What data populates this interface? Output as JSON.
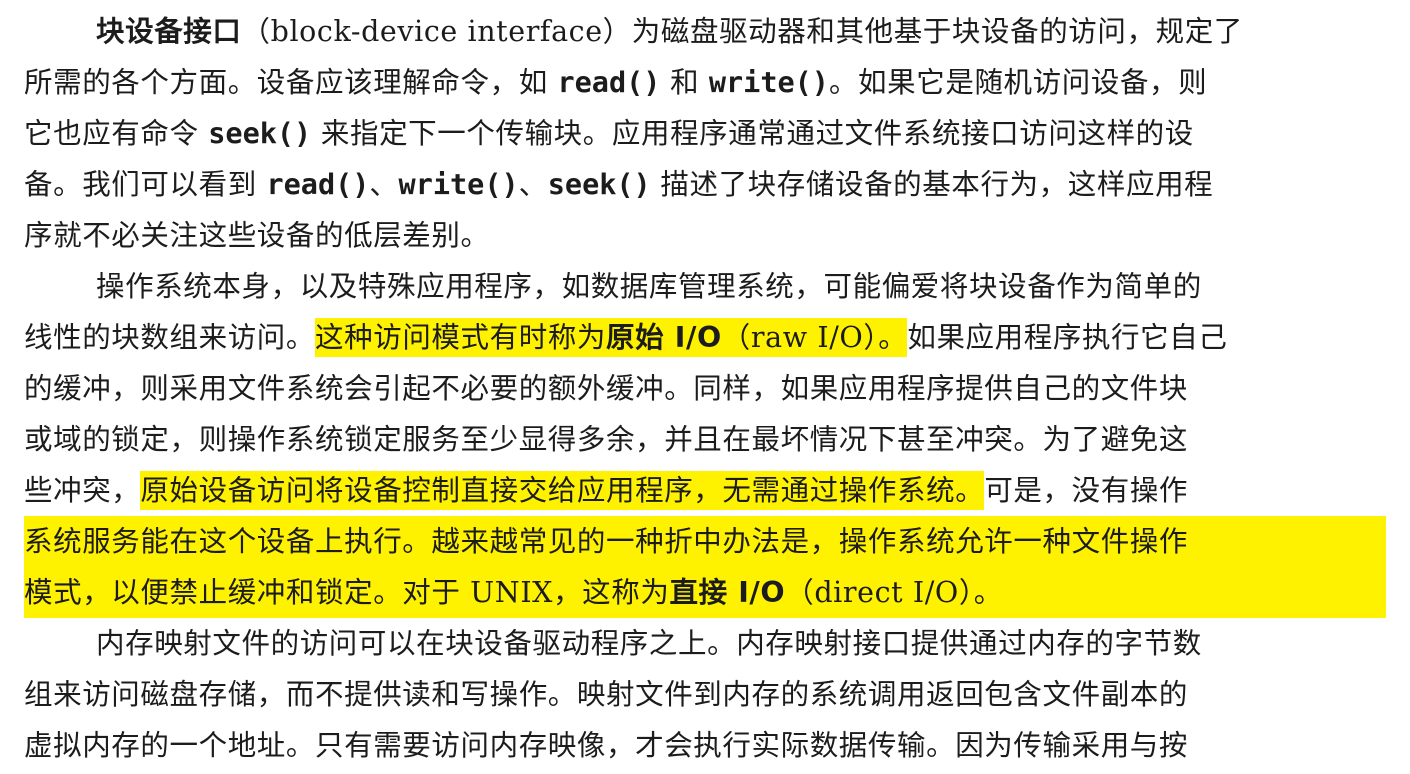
{
  "paragraphs": [
    {
      "lines": [
        [
          {
            "t": "块设备接口",
            "b": true
          },
          {
            "t": "（block-device interface）为磁盘驱动器和其他基于块设备的访问，规定了"
          }
        ],
        [
          {
            "t": "所需的各个方面。设备应该理解命令，如 "
          },
          {
            "t": "read()",
            "m": true
          },
          {
            "t": " 和 "
          },
          {
            "t": "write()",
            "m": true
          },
          {
            "t": "。如果它是随机访问设备，则"
          }
        ],
        [
          {
            "t": "它也应有命令 "
          },
          {
            "t": "seek()",
            "m": true
          },
          {
            "t": " 来指定下一个传输块。应用程序通常通过文件系统接口访问这样的设"
          }
        ],
        [
          {
            "t": "备。我们可以看到 "
          },
          {
            "t": "read()",
            "m": true
          },
          {
            "t": "、"
          },
          {
            "t": "write()",
            "m": true
          },
          {
            "t": "、"
          },
          {
            "t": "seek()",
            "m": true
          },
          {
            "t": " 描述了块存储设备的基本行为，这样应用程"
          }
        ],
        [
          {
            "t": "序就不必关注这些设备的低层差别。"
          }
        ]
      ]
    },
    {
      "lines": [
        [
          {
            "t": "操作系统本身，以及特殊应用程序，如数据库管理系统，可能偏爱将块设备作为简单的"
          }
        ],
        [
          {
            "t": "线性的块数组来访问。"
          },
          {
            "t": "这种访问模式有时称为",
            "h": true
          },
          {
            "t": "原始 I/O",
            "h": true,
            "b": true
          },
          {
            "t": "（raw I/O）。",
            "h": true
          },
          {
            "t": "如果应用程序执行它自己"
          }
        ],
        [
          {
            "t": "的缓冲，则采用文件系统会引起不必要的额外缓冲。同样，如果应用程序提供自己的文件块"
          }
        ],
        [
          {
            "t": "或域的锁定，则操作系统锁定服务至少显得多余，并且在最坏情况下甚至冲突。为了避免这"
          }
        ],
        [
          {
            "t": "些冲突，"
          },
          {
            "t": "原始设备访问将设备控制直接交给应用程序，无需通过操作系统。",
            "h": true
          },
          {
            "t": "可是，没有操作"
          }
        ],
        [
          {
            "t": "系统服务能在这个设备上执行。越来越常见的一种折中办法是，操作系统允许一种文件操作",
            "hb": true
          }
        ],
        [
          {
            "t": "模式，以便禁止缓冲和锁定。对于 UNIX，这称为",
            "hb": true
          },
          {
            "t": "直接 I/O",
            "hb": true,
            "b": true
          },
          {
            "t": "（direct I/O）。",
            "hb": true
          }
        ]
      ]
    },
    {
      "lines": [
        [
          {
            "t": "内存映射文件的访问可以在块设备驱动程序之上。内存映射接口提供通过内存的字节数"
          }
        ],
        [
          {
            "t": "组来访问磁盘存储，而不提供读和写操作。映射文件到内存的系统调用返回包含文件副本的"
          }
        ],
        [
          {
            "t": "虚拟内存的一个地址。只有需要访问内存映像，才会执行实际数据传输。因为传输采用与按"
          }
        ]
      ]
    }
  ],
  "colors": {
    "highlight": "#fff200",
    "text": "#1c1c1c"
  }
}
